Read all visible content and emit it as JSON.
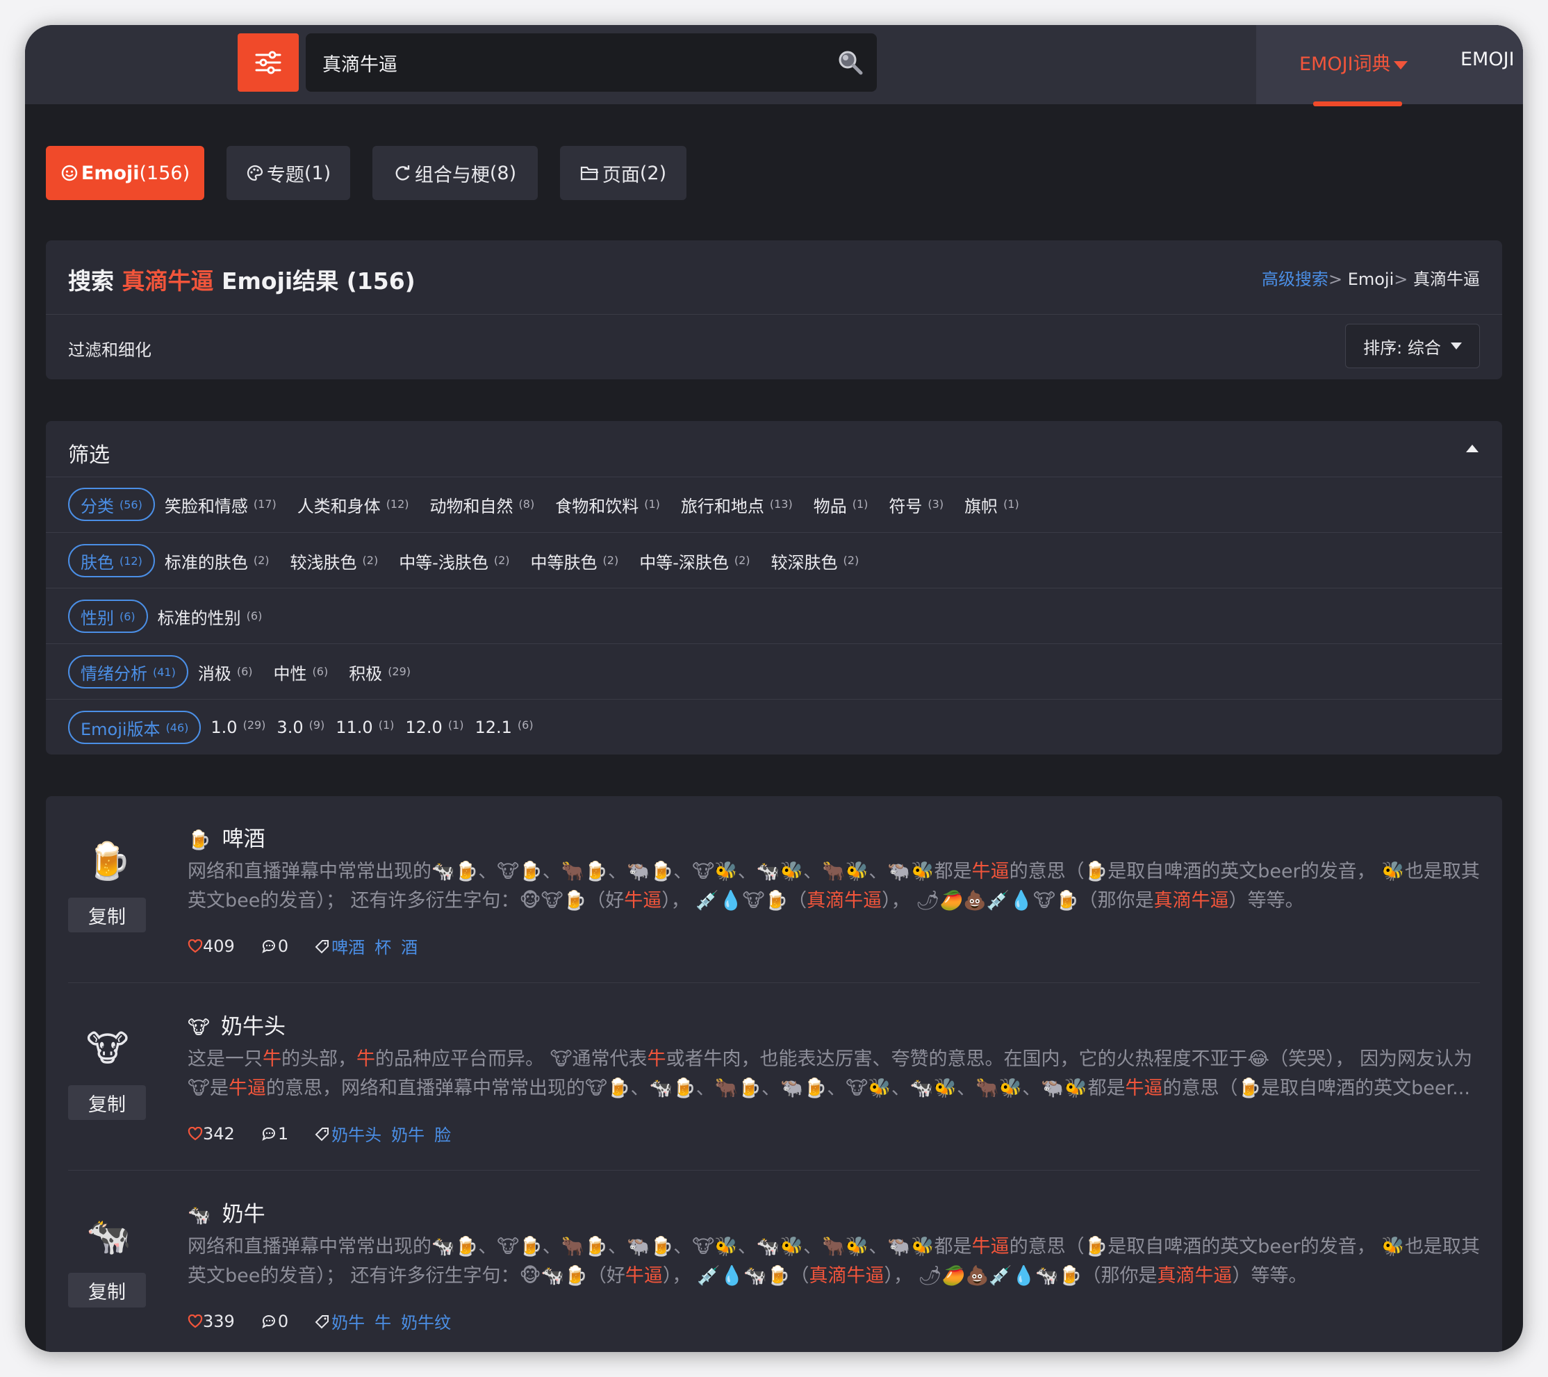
{
  "header": {
    "search_value": "真滴牛逼",
    "nav_dict_label": "EMOJI词典",
    "nav_second_label": "EMOJI"
  },
  "tabs": [
    {
      "icon": "😊",
      "label": "Emoji",
      "count": "(156)"
    },
    {
      "icon": "🎨",
      "label": "专题",
      "count": "(1)"
    },
    {
      "icon": "⟳",
      "label": "组合与梗",
      "count": "(8)"
    },
    {
      "icon": "🗀",
      "label": "页面",
      "count": "(2)"
    }
  ],
  "results": {
    "prefix": "搜索",
    "query": "真滴牛逼",
    "suffix": "Emoji结果 (156)",
    "breadcrumb": {
      "link": "高级搜索",
      "sep": ">",
      "level1": "Emoji",
      "level2": "真滴牛逼"
    },
    "filter_label": "过滤和细化",
    "sort_label": "排序: 综合"
  },
  "filters": {
    "title": "筛选",
    "rows": [
      {
        "pill": {
          "label": "分类",
          "count": "(56)"
        },
        "items": [
          {
            "label": "笑脸和情感",
            "count": "(17)"
          },
          {
            "label": "人类和身体",
            "count": "(12)"
          },
          {
            "label": "动物和自然",
            "count": "(8)"
          },
          {
            "label": "食物和饮料",
            "count": "(1)"
          },
          {
            "label": "旅行和地点",
            "count": "(13)"
          },
          {
            "label": "物品",
            "count": "(1)"
          },
          {
            "label": "符号",
            "count": "(3)"
          },
          {
            "label": "旗帜",
            "count": "(1)"
          }
        ]
      },
      {
        "pill": {
          "label": "肤色",
          "count": "(12)"
        },
        "items": [
          {
            "label": "标准的肤色",
            "count": "(2)"
          },
          {
            "label": "较浅肤色",
            "count": "(2)"
          },
          {
            "label": "中等-浅肤色",
            "count": "(2)"
          },
          {
            "label": "中等肤色",
            "count": "(2)"
          },
          {
            "label": "中等-深肤色",
            "count": "(2)"
          },
          {
            "label": "较深肤色",
            "count": "(2)"
          }
        ]
      },
      {
        "pill": {
          "label": "性别",
          "count": "(6)"
        },
        "items": [
          {
            "label": "标准的性别",
            "count": "(6)"
          }
        ]
      },
      {
        "pill": {
          "label": "情绪分析",
          "count": "(41)"
        },
        "items": [
          {
            "label": "消极",
            "count": "(6)"
          },
          {
            "label": "中性",
            "count": "(6)"
          },
          {
            "label": "积极",
            "count": "(29)"
          }
        ]
      },
      {
        "pill": {
          "label": "Emoji版本",
          "count": "(46)"
        },
        "items": [
          {
            "label": "1.0",
            "count": "(29)"
          },
          {
            "label": "3.0",
            "count": "(9)"
          },
          {
            "label": "11.0",
            "count": "(1)"
          },
          {
            "label": "12.0",
            "count": "(1)"
          },
          {
            "label": "12.1",
            "count": "(6)"
          }
        ]
      }
    ]
  },
  "entries": [
    {
      "emoji": "🍺",
      "name": "啤酒",
      "copy_label": "复制",
      "likes": "409",
      "comments": "0",
      "tags": [
        "啤酒",
        "杯",
        "酒"
      ],
      "desc": [
        {
          "t": "网络和直播弹幕中常常出现的🐄🍺、🐮🍺、🐂🍺、🐃🍺、🐮🐝、🐄🐝、🐂🐝、🐃🐝都是"
        },
        {
          "t": "牛逼",
          "h": true
        },
        {
          "t": "的意思（🍺是取自啤酒的英文beer的发音， 🐝也是取其英文bee的发音）； 还有许多衍生字句：🐵🐮🍺（好"
        },
        {
          "t": "牛逼",
          "h": true
        },
        {
          "t": "）， 💉💧🐮🍺（"
        },
        {
          "t": "真滴牛逼",
          "h": true
        },
        {
          "t": "）， 🌶🥭💩💉💧🐮🍺（那你是"
        },
        {
          "t": "真滴牛逼",
          "h": true
        },
        {
          "t": "）等等。"
        }
      ]
    },
    {
      "emoji": "🐮",
      "name": "奶牛头",
      "copy_label": "复制",
      "likes": "342",
      "comments": "1",
      "tags": [
        "奶牛头",
        "奶牛",
        "脸"
      ],
      "desc": [
        {
          "t": "这是一只"
        },
        {
          "t": "牛",
          "h": true
        },
        {
          "t": "的头部，"
        },
        {
          "t": "牛",
          "h": true
        },
        {
          "t": "的品种应平台而异。 🐮通常代表"
        },
        {
          "t": "牛",
          "h": true
        },
        {
          "t": "或者牛肉，也能表达厉害、夸赞的意思。在国内，它的火热程度不亚于😂（笑哭）， 因为网友认为🐮是"
        },
        {
          "t": "牛逼",
          "h": true
        },
        {
          "t": "的意思，网络和直播弹幕中常常出现的🐮🍺、🐄🍺、🐂🍺、🐃🍺、🐮🐝、🐄🐝、🐂🐝、🐃🐝都是"
        },
        {
          "t": "牛逼",
          "h": true
        },
        {
          "t": "的意思（🍺是取自啤酒的英文beer..."
        }
      ]
    },
    {
      "emoji": "🐄",
      "name": "奶牛",
      "copy_label": "复制",
      "likes": "339",
      "comments": "0",
      "tags": [
        "奶牛",
        "牛",
        "奶牛纹"
      ],
      "desc": [
        {
          "t": "网络和直播弹幕中常常出现的🐄🍺、🐮🍺、🐂🍺、🐃🍺、🐮🐝、🐄🐝、🐂🐝、🐃🐝都是"
        },
        {
          "t": "牛逼",
          "h": true
        },
        {
          "t": "的意思（🍺是取自啤酒的英文beer的发音， 🐝也是取其英文bee的发音）； 还有许多衍生字句：🐵🐄🍺（好"
        },
        {
          "t": "牛逼",
          "h": true
        },
        {
          "t": "）， 💉💧🐄🍺（"
        },
        {
          "t": "真滴牛逼",
          "h": true
        },
        {
          "t": "）， 🌶🥭💩💉💧🐄🍺（那你是"
        },
        {
          "t": "真滴牛逼",
          "h": true
        },
        {
          "t": "）等等。"
        }
      ]
    }
  ]
}
